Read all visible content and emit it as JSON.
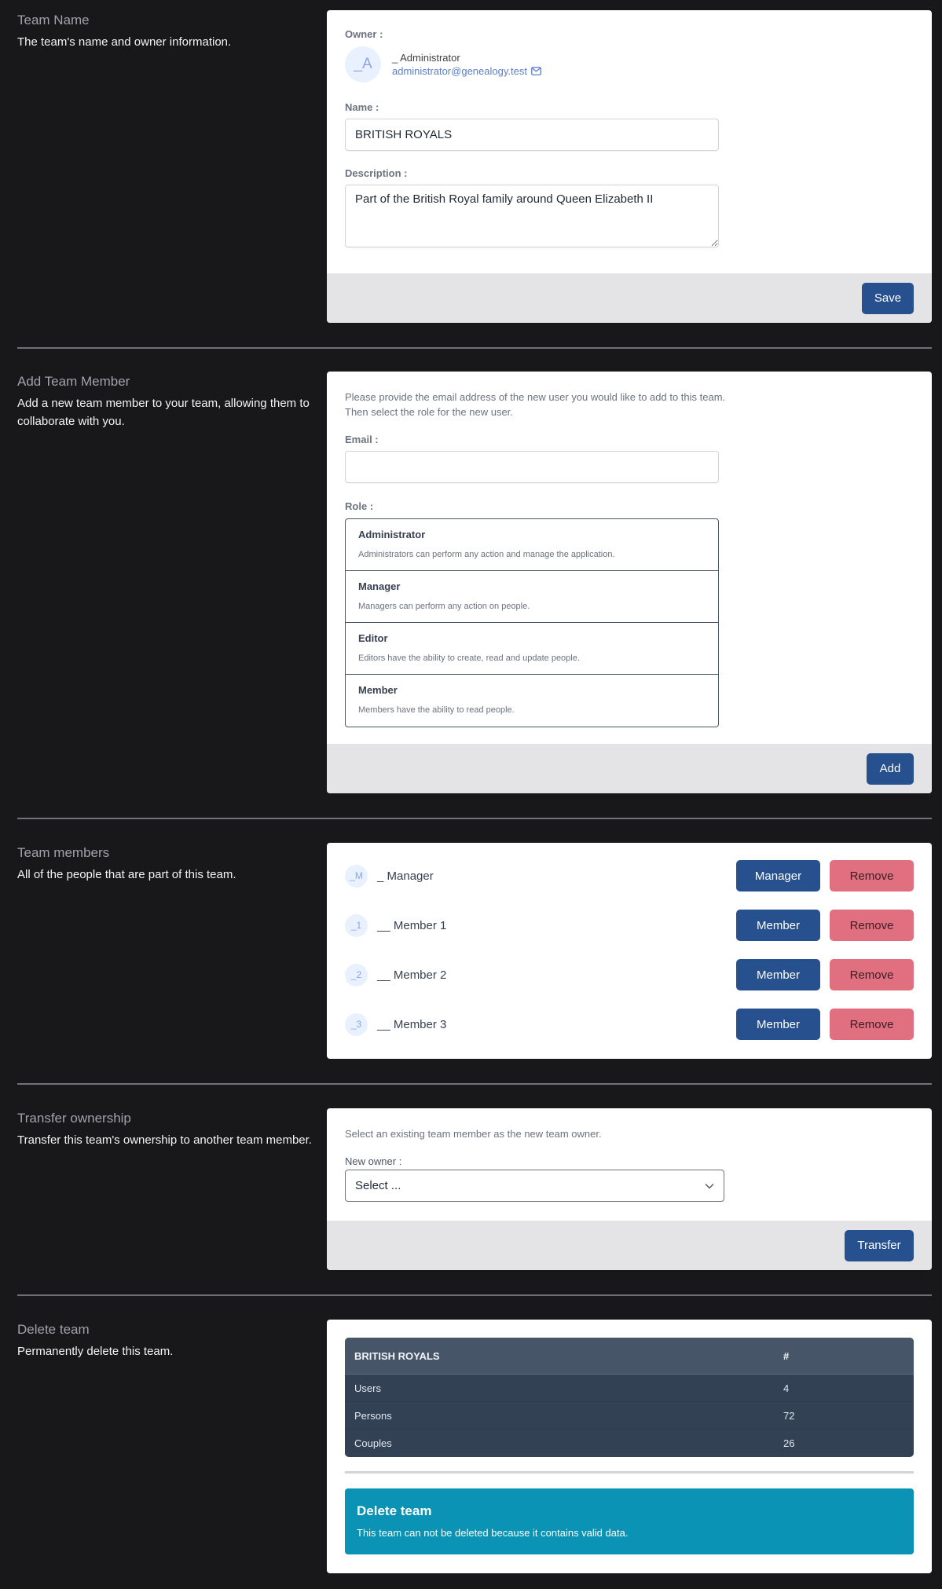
{
  "team_name_section": {
    "title": "Team Name",
    "description": "The team's name and owner information.",
    "owner_label": "Owner :",
    "owner": {
      "initials": "_A",
      "name": "_ Administrator",
      "email": "administrator@genealogy.test",
      "email_icon": "mail-icon"
    },
    "name_label": "Name :",
    "name_value": "BRITISH ROYALS",
    "description_label": "Description :",
    "description_value": "Part of the British Royal family around Queen Elizabeth II",
    "save_label": "Save"
  },
  "add_member_section": {
    "title": "Add Team Member",
    "description": "Add a new team member to your team, allowing them to collaborate with you.",
    "hint_line1": "Please provide the email address of the new user you would like to add to this team.",
    "hint_line2": "Then select the role for the new user.",
    "email_label": "Email :",
    "email_value": "",
    "role_label": "Role :",
    "roles": [
      {
        "name": "Administrator",
        "description": "Administrators can perform any action and manage the application."
      },
      {
        "name": "Manager",
        "description": "Managers can perform any action on people."
      },
      {
        "name": "Editor",
        "description": "Editors have the ability to create, read and update people."
      },
      {
        "name": "Member",
        "description": "Members have the ability to read people."
      }
    ],
    "add_label": "Add"
  },
  "members_section": {
    "title": "Team members",
    "description": "All of the people that are part of this team.",
    "members": [
      {
        "initials": "_M",
        "name": "_ Manager",
        "role": "Manager",
        "remove_label": "Remove"
      },
      {
        "initials": "_1",
        "name": "__ Member 1",
        "role": "Member",
        "remove_label": "Remove"
      },
      {
        "initials": "_2",
        "name": "__ Member 2",
        "role": "Member",
        "remove_label": "Remove"
      },
      {
        "initials": "_3",
        "name": "__ Member 3",
        "role": "Member",
        "remove_label": "Remove"
      }
    ]
  },
  "transfer_section": {
    "title": "Transfer ownership",
    "description": "Transfer this team's ownership to another team member.",
    "hint": "Select an existing team member as the new team owner.",
    "new_owner_label": "New owner :",
    "select_value": "Select ...",
    "transfer_label": "Transfer"
  },
  "delete_section": {
    "title": "Delete team",
    "description": "Permanently delete this team.",
    "table": {
      "headers": [
        "BRITISH ROYALS",
        "#"
      ],
      "rows": [
        [
          "Users",
          "4"
        ],
        [
          "Persons",
          "72"
        ],
        [
          "Couples",
          "26"
        ]
      ]
    },
    "alert_title": "Delete team",
    "alert_text": "This team can not be deleted because it contains valid data."
  },
  "colors": {
    "background": "#18181b",
    "primary": "#27508e",
    "danger": "#e06f80",
    "info": "#0b93b5",
    "table_bg": "#334155"
  }
}
